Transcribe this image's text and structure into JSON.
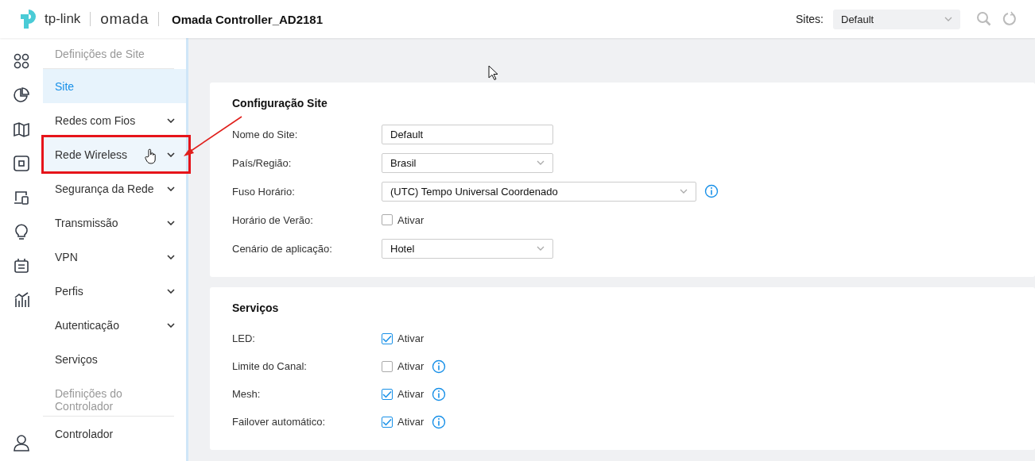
{
  "header": {
    "brand": "tp-link",
    "product": "omada",
    "title": "Omada Controller_AD2181",
    "sites_label": "Sites:",
    "site": "Default"
  },
  "nav": [
    {
      "kind": "heading",
      "label": "Definições de Site"
    },
    {
      "kind": "item",
      "label": "Site",
      "selected": true,
      "expandable": false,
      "hovered": false,
      "annotated": false
    },
    {
      "kind": "item",
      "label": "Redes com Fios",
      "selected": false,
      "expandable": true,
      "hovered": false,
      "annotated": false
    },
    {
      "kind": "item",
      "label": "Rede Wireless",
      "selected": false,
      "expandable": true,
      "hovered": true,
      "annotated": true
    },
    {
      "kind": "item",
      "label": "Segurança da Rede",
      "selected": false,
      "expandable": true,
      "hovered": false,
      "annotated": false
    },
    {
      "kind": "item",
      "label": "Transmissão",
      "selected": false,
      "expandable": true,
      "hovered": false,
      "annotated": false
    },
    {
      "kind": "item",
      "label": "VPN",
      "selected": false,
      "expandable": true,
      "hovered": false,
      "annotated": false
    },
    {
      "kind": "item",
      "label": "Perfis",
      "selected": false,
      "expandable": true,
      "hovered": false,
      "annotated": false
    },
    {
      "kind": "item",
      "label": "Autenticação",
      "selected": false,
      "expandable": true,
      "hovered": false,
      "annotated": false
    },
    {
      "kind": "item",
      "label": "Serviços",
      "selected": false,
      "expandable": false,
      "hovered": false,
      "annotated": false
    },
    {
      "kind": "heading",
      "label": "Definições do Controlador"
    },
    {
      "kind": "item",
      "label": "Controlador",
      "selected": false,
      "expandable": false,
      "hovered": false,
      "annotated": false
    }
  ],
  "sections": [
    {
      "title": "Configuração Site",
      "fields": [
        {
          "kind": "text",
          "label": "Nome do Site:",
          "value": "Default",
          "info": false
        },
        {
          "kind": "select",
          "label": "País/Região:",
          "value": "Brasil",
          "info": false
        },
        {
          "kind": "select-wide",
          "label": "Fuso Horário:",
          "value": "(UTC) Tempo Universal Coordenado",
          "info": true
        },
        {
          "kind": "checkbox",
          "label": "Horário de Verão:",
          "value": "Ativar",
          "checked": false,
          "info": false
        },
        {
          "kind": "select",
          "label": "Cenário de aplicação:",
          "value": "Hotel",
          "info": false
        }
      ]
    },
    {
      "title": "Serviços",
      "fields": [
        {
          "kind": "checkbox",
          "label": "LED:",
          "value": "Ativar",
          "checked": true,
          "info": false
        },
        {
          "kind": "checkbox",
          "label": "Limite do Canal:",
          "value": "Ativar",
          "checked": false,
          "info": true
        },
        {
          "kind": "checkbox",
          "label": "Mesh:",
          "value": "Ativar",
          "checked": true,
          "info": true
        },
        {
          "kind": "checkbox",
          "label": "Failover automático:",
          "value": "Ativar",
          "checked": true,
          "info": true
        }
      ]
    }
  ]
}
